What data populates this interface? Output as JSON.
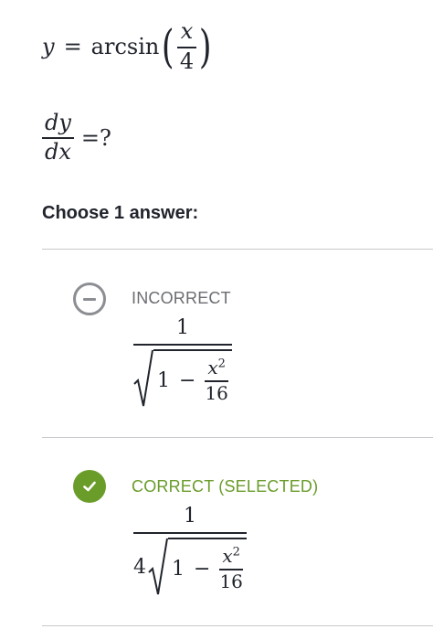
{
  "question": {
    "line1": {
      "lhs": "y",
      "equals": "=",
      "func": "arcsin",
      "open_paren": "(",
      "close_paren": ")",
      "arg_numerator": "x",
      "arg_denominator": "4"
    },
    "line2": {
      "numerator": "dy",
      "denominator": "dx",
      "tail": "=?"
    }
  },
  "prompt": "Choose 1 answer:",
  "choices": [
    {
      "status": "INCORRECT",
      "status_color": "#8c8e93",
      "icon": "minus-circle-icon",
      "numerator": "1",
      "coefficient": "",
      "radicand_one": "1",
      "radicand_minus": "−",
      "frac_numerator_base": "x",
      "frac_numerator_exp": "2",
      "frac_denominator": "16"
    },
    {
      "status": "CORRECT (SELECTED)",
      "status_color": "#6a9c2a",
      "icon": "check-circle-icon",
      "numerator": "1",
      "coefficient": "4",
      "radicand_one": "1",
      "radicand_minus": "−",
      "frac_numerator_base": "x",
      "frac_numerator_exp": "2",
      "frac_denominator": "16"
    }
  ]
}
